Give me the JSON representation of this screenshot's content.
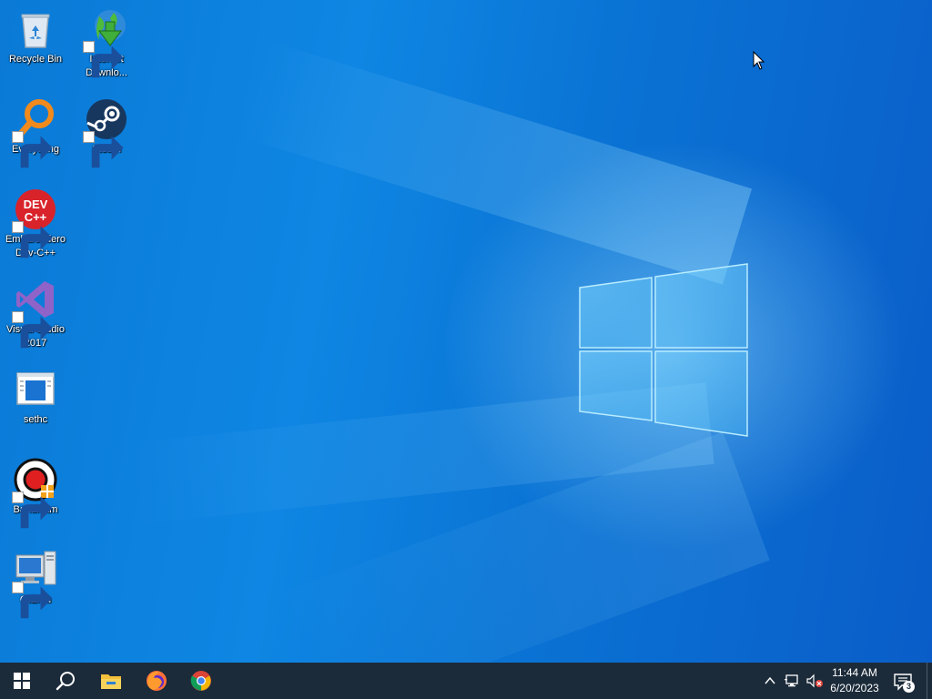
{
  "desktop": {
    "icons": [
      {
        "label": "Recycle Bin",
        "icon": "recycle-bin-icon",
        "shortcut": false
      },
      {
        "label": "Internet Downlo...",
        "icon": "internet-download-manager-icon",
        "shortcut": true
      },
      {
        "label": "Everything",
        "icon": "everything-search-icon",
        "shortcut": true
      },
      {
        "label": "Steam",
        "icon": "steam-icon",
        "shortcut": true
      },
      {
        "label": "Embarcadero Dev-C++",
        "icon": "dev-cpp-icon",
        "shortcut": true,
        "icon_text": [
          "DEV",
          "C++"
        ]
      },
      {
        "label": "Visual Studio 2017",
        "icon": "visual-studio-icon",
        "shortcut": true
      },
      {
        "label": "sethc",
        "icon": "sethc-app-icon",
        "shortcut": false
      },
      {
        "label": "Bandicam",
        "icon": "bandicam-icon",
        "shortcut": true
      },
      {
        "label": "QtEmu",
        "icon": "qtemu-icon",
        "shortcut": true
      }
    ],
    "wallpaper": "windows-10-default-wallpaper"
  },
  "taskbar": {
    "start": {
      "icon": "windows-start-icon"
    },
    "search": {
      "icon": "search-icon"
    },
    "pinned": [
      {
        "name": "File Explorer",
        "icon": "file-explorer-icon"
      },
      {
        "name": "Firefox",
        "icon": "firefox-icon"
      },
      {
        "name": "Google Chrome",
        "icon": "chrome-icon"
      }
    ],
    "tray": {
      "chevron": "chevron-up-icon",
      "network": "network-icon",
      "volume": "volume-muted-icon",
      "time": "11:44 AM",
      "date": "6/20/2023",
      "notifications_count": "3"
    }
  },
  "colors": {
    "taskbar_bg": "#1c2b3a",
    "wallpaper_blue": "#0a7ad6"
  }
}
